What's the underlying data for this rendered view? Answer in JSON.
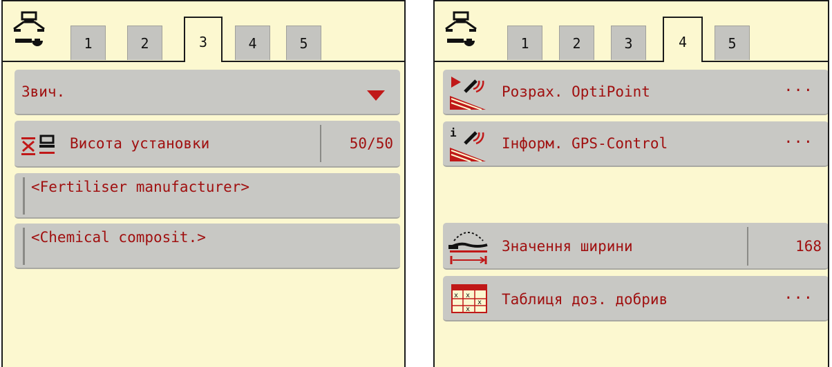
{
  "left_panel": {
    "tabs": [
      "1",
      "2",
      "3",
      "4",
      "5"
    ],
    "active_tab": "3",
    "dropdown": {
      "value": "Звич."
    },
    "height_row": {
      "label": "Висота установки",
      "value": "50/50"
    },
    "fertiliser_field": {
      "value": "<Fertiliser manufacturer>"
    },
    "composition_field": {
      "value": "<Chemical composit.>"
    }
  },
  "right_panel": {
    "tabs": [
      "1",
      "2",
      "3",
      "4",
      "5"
    ],
    "active_tab": "4",
    "menu": [
      {
        "label": "Розрах. OptiPoint",
        "trailing": "···"
      },
      {
        "label": "Інформ. GPS-Control",
        "trailing": "···"
      }
    ],
    "width_row": {
      "label": "Значення ширини",
      "value": "168"
    },
    "table_row": {
      "label": "Таблиця доз. добрив",
      "trailing": "···"
    }
  },
  "colors": {
    "background": "#fcf8d0",
    "row": "#c8c8c4",
    "text_accent": "#a01010",
    "tab": "#c4c4c0"
  },
  "icons": {
    "settings": "machine-settings-icon",
    "height": "height-settings-icon",
    "optipoint": "optipoint-icon",
    "gps_info": "gps-control-info-icon",
    "width": "spread-width-icon",
    "table": "fertiliser-table-icon"
  }
}
